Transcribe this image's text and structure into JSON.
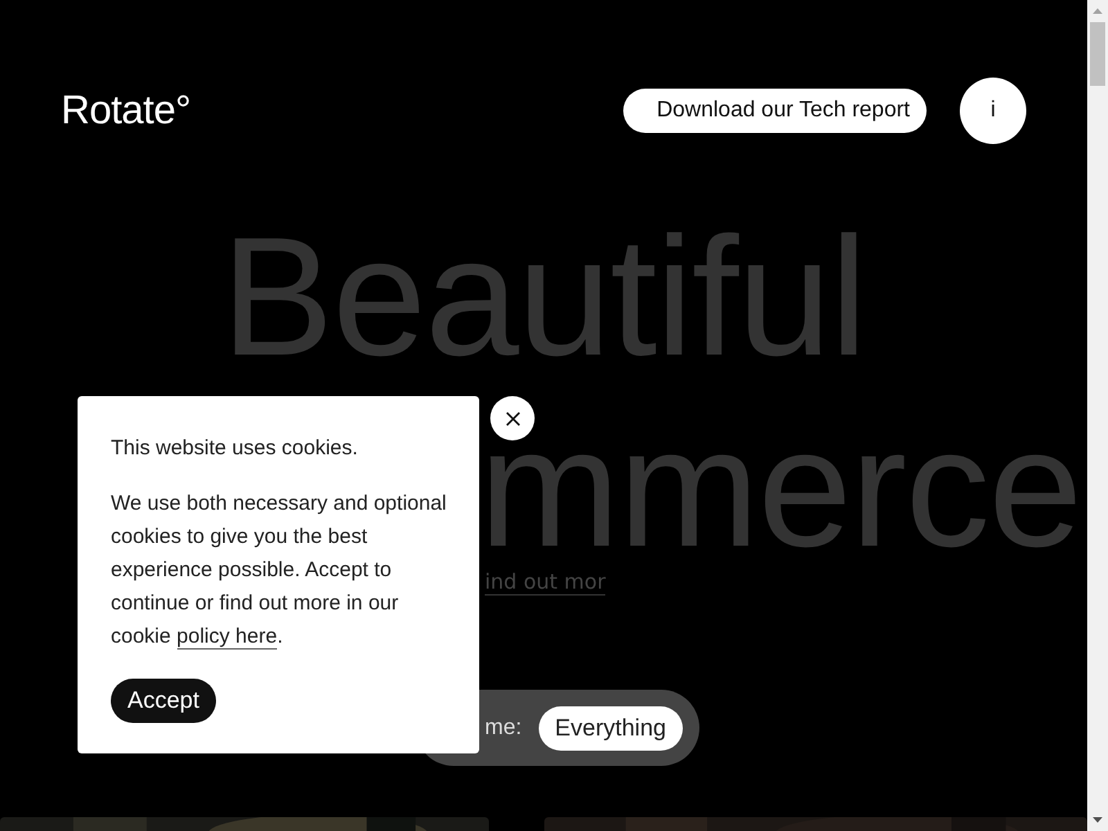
{
  "header": {
    "logo": "Rotate°",
    "report_button": "Download our Tech report",
    "info_button": "i"
  },
  "hero": {
    "lines": [
      "Beautiful",
      "mmerce"
    ],
    "link": "ind out mor"
  },
  "filter": {
    "label": "me:",
    "options": [
      {
        "label": "Everything",
        "selected": true
      }
    ]
  },
  "cookie_dialog": {
    "title": "This website uses cookies.",
    "body": "We use both necessary and optional cookies to give you the best experience possible. Accept to continue or find out more in our cookie ",
    "link": "policy here",
    "after": ".",
    "accept_button": "Accept"
  }
}
